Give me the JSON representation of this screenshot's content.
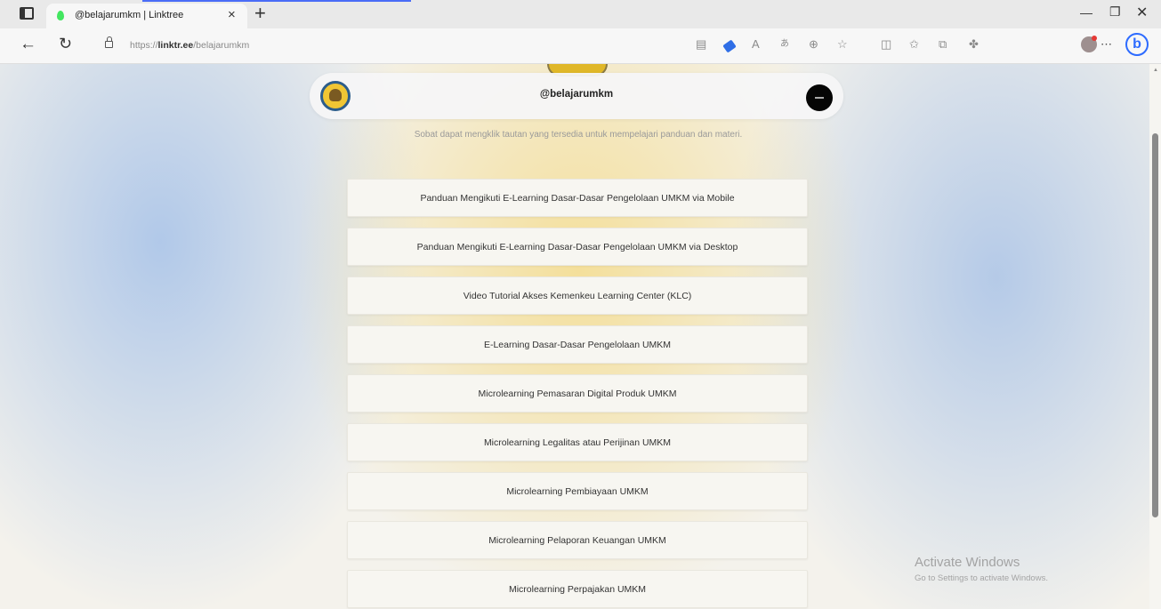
{
  "browser": {
    "tab": {
      "title": "@belajarumkm | Linktree"
    },
    "address": {
      "url_prefix": "https://",
      "url_domain": "linktr.ee",
      "url_path": "/belajarumkm"
    }
  },
  "profile": {
    "handle": "@belajarumkm",
    "description": "Sobat dapat mengklik tautan yang tersedia untuk mempelajari panduan dan materi."
  },
  "links": [
    "Panduan Mengikuti E-Learning Dasar-Dasar Pengelolaan UMKM via Mobile",
    "Panduan Mengikuti E-Learning Dasar-Dasar Pengelolaan UMKM via Desktop",
    "Video Tutorial Akses Kemenkeu Learning Center (KLC)",
    "E-Learning Dasar-Dasar Pengelolaan UMKM",
    "Microlearning Pemasaran Digital Produk UMKM",
    "Microlearning Legalitas atau Perijinan UMKM",
    "Microlearning Pembiayaan UMKM",
    "Microlearning Pelaporan Keuangan UMKM",
    "Microlearning Perpajakan UMKM"
  ],
  "watermark": {
    "title": "Activate Windows",
    "subtitle": "Go to Settings to activate Windows."
  },
  "colors": {
    "accent_blue": "#2d6bff",
    "linktree_green": "#43e660",
    "logo_gold": "#f0c634"
  },
  "icons": [
    "tab-actions-icon",
    "favicon-icon",
    "close-icon",
    "plus-icon",
    "back-icon",
    "refresh-icon",
    "lock-icon",
    "reader-icon",
    "tag-icon",
    "read-aloud-icon",
    "translate-icon",
    "zoom-icon",
    "favorite-icon",
    "split-icon",
    "favorites-icon",
    "collections-icon",
    "extensions-icon",
    "profile-icon",
    "more-icon",
    "bing-icon",
    "menu-icon"
  ]
}
